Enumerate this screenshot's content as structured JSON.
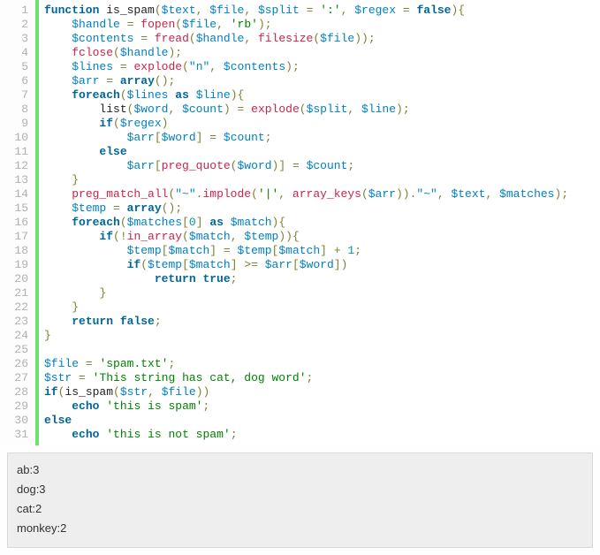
{
  "code": {
    "line_count": 31,
    "tokens": [
      [
        [
          "kw",
          "function"
        ],
        [
          "plain",
          " is_spam"
        ],
        [
          "op",
          "("
        ],
        [
          "var",
          "$text"
        ],
        [
          "op",
          ","
        ],
        [
          "plain",
          " "
        ],
        [
          "var",
          "$file"
        ],
        [
          "op",
          ","
        ],
        [
          "plain",
          " "
        ],
        [
          "var",
          "$split"
        ],
        [
          "plain",
          " "
        ],
        [
          "op",
          "="
        ],
        [
          "plain",
          " "
        ],
        [
          "strq",
          "':'"
        ],
        [
          "op",
          ","
        ],
        [
          "plain",
          " "
        ],
        [
          "var",
          "$regex"
        ],
        [
          "plain",
          " "
        ],
        [
          "op",
          "="
        ],
        [
          "plain",
          " "
        ],
        [
          "kw",
          "false"
        ],
        [
          "op",
          ")"
        ],
        [
          "op",
          "{"
        ]
      ],
      [
        [
          "plain",
          "    "
        ],
        [
          "var",
          "$handle"
        ],
        [
          "plain",
          " "
        ],
        [
          "op",
          "="
        ],
        [
          "plain",
          " "
        ],
        [
          "fn",
          "fopen"
        ],
        [
          "op",
          "("
        ],
        [
          "var",
          "$file"
        ],
        [
          "op",
          ","
        ],
        [
          "plain",
          " "
        ],
        [
          "strq",
          "'rb'"
        ],
        [
          "op",
          ")"
        ],
        [
          "op",
          ";"
        ]
      ],
      [
        [
          "plain",
          "    "
        ],
        [
          "var",
          "$contents"
        ],
        [
          "plain",
          " "
        ],
        [
          "op",
          "="
        ],
        [
          "plain",
          " "
        ],
        [
          "fn",
          "fread"
        ],
        [
          "op",
          "("
        ],
        [
          "var",
          "$handle"
        ],
        [
          "op",
          ","
        ],
        [
          "plain",
          " "
        ],
        [
          "fn",
          "filesize"
        ],
        [
          "op",
          "("
        ],
        [
          "var",
          "$file"
        ],
        [
          "op",
          ")"
        ],
        [
          "op",
          ")"
        ],
        [
          "op",
          ";"
        ]
      ],
      [
        [
          "plain",
          "    "
        ],
        [
          "fn",
          "fclose"
        ],
        [
          "op",
          "("
        ],
        [
          "var",
          "$handle"
        ],
        [
          "op",
          ")"
        ],
        [
          "op",
          ";"
        ]
      ],
      [
        [
          "plain",
          "    "
        ],
        [
          "var",
          "$lines"
        ],
        [
          "plain",
          " "
        ],
        [
          "op",
          "="
        ],
        [
          "plain",
          " "
        ],
        [
          "fn",
          "explode"
        ],
        [
          "op",
          "("
        ],
        [
          "str",
          "\"n\""
        ],
        [
          "op",
          ","
        ],
        [
          "plain",
          " "
        ],
        [
          "var",
          "$contents"
        ],
        [
          "op",
          ")"
        ],
        [
          "op",
          ";"
        ]
      ],
      [
        [
          "plain",
          "    "
        ],
        [
          "var",
          "$arr"
        ],
        [
          "plain",
          " "
        ],
        [
          "op",
          "="
        ],
        [
          "plain",
          " "
        ],
        [
          "kw",
          "array"
        ],
        [
          "op",
          "("
        ],
        [
          "op",
          ")"
        ],
        [
          "op",
          ";"
        ]
      ],
      [
        [
          "plain",
          "    "
        ],
        [
          "kw",
          "foreach"
        ],
        [
          "op",
          "("
        ],
        [
          "var",
          "$lines"
        ],
        [
          "plain",
          " "
        ],
        [
          "kw",
          "as"
        ],
        [
          "plain",
          " "
        ],
        [
          "var",
          "$line"
        ],
        [
          "op",
          ")"
        ],
        [
          "op",
          "{"
        ]
      ],
      [
        [
          "plain",
          "        list"
        ],
        [
          "op",
          "("
        ],
        [
          "var",
          "$word"
        ],
        [
          "op",
          ","
        ],
        [
          "plain",
          " "
        ],
        [
          "var",
          "$count"
        ],
        [
          "op",
          ")"
        ],
        [
          "plain",
          " "
        ],
        [
          "op",
          "="
        ],
        [
          "plain",
          " "
        ],
        [
          "fn",
          "explode"
        ],
        [
          "op",
          "("
        ],
        [
          "var",
          "$split"
        ],
        [
          "op",
          ","
        ],
        [
          "plain",
          " "
        ],
        [
          "var",
          "$line"
        ],
        [
          "op",
          ")"
        ],
        [
          "op",
          ";"
        ]
      ],
      [
        [
          "plain",
          "        "
        ],
        [
          "kw",
          "if"
        ],
        [
          "op",
          "("
        ],
        [
          "var",
          "$regex"
        ],
        [
          "op",
          ")"
        ]
      ],
      [
        [
          "plain",
          "            "
        ],
        [
          "var",
          "$arr"
        ],
        [
          "op",
          "["
        ],
        [
          "var",
          "$word"
        ],
        [
          "op",
          "]"
        ],
        [
          "plain",
          " "
        ],
        [
          "op",
          "="
        ],
        [
          "plain",
          " "
        ],
        [
          "var",
          "$count"
        ],
        [
          "op",
          ";"
        ]
      ],
      [
        [
          "plain",
          "        "
        ],
        [
          "kw",
          "else"
        ]
      ],
      [
        [
          "plain",
          "            "
        ],
        [
          "var",
          "$arr"
        ],
        [
          "op",
          "["
        ],
        [
          "fn",
          "preg_quote"
        ],
        [
          "op",
          "("
        ],
        [
          "var",
          "$word"
        ],
        [
          "op",
          ")"
        ],
        [
          "op",
          "]"
        ],
        [
          "plain",
          " "
        ],
        [
          "op",
          "="
        ],
        [
          "plain",
          " "
        ],
        [
          "var",
          "$count"
        ],
        [
          "op",
          ";"
        ]
      ],
      [
        [
          "plain",
          "    "
        ],
        [
          "op",
          "}"
        ]
      ],
      [
        [
          "plain",
          "    "
        ],
        [
          "fn",
          "preg_match_all"
        ],
        [
          "op",
          "("
        ],
        [
          "str",
          "\"~\""
        ],
        [
          "op",
          "."
        ],
        [
          "fn",
          "implode"
        ],
        [
          "op",
          "("
        ],
        [
          "strq",
          "'|'"
        ],
        [
          "op",
          ","
        ],
        [
          "plain",
          " "
        ],
        [
          "fn",
          "array_keys"
        ],
        [
          "op",
          "("
        ],
        [
          "var",
          "$arr"
        ],
        [
          "op",
          ")"
        ],
        [
          "op",
          ")"
        ],
        [
          "op",
          "."
        ],
        [
          "str",
          "\"~\""
        ],
        [
          "op",
          ","
        ],
        [
          "plain",
          " "
        ],
        [
          "var",
          "$text"
        ],
        [
          "op",
          ","
        ],
        [
          "plain",
          " "
        ],
        [
          "var",
          "$matches"
        ],
        [
          "op",
          ")"
        ],
        [
          "op",
          ";"
        ]
      ],
      [
        [
          "plain",
          "    "
        ],
        [
          "var",
          "$temp"
        ],
        [
          "plain",
          " "
        ],
        [
          "op",
          "="
        ],
        [
          "plain",
          " "
        ],
        [
          "kw",
          "array"
        ],
        [
          "op",
          "("
        ],
        [
          "op",
          ")"
        ],
        [
          "op",
          ";"
        ]
      ],
      [
        [
          "plain",
          "    "
        ],
        [
          "kw",
          "foreach"
        ],
        [
          "op",
          "("
        ],
        [
          "var",
          "$matches"
        ],
        [
          "op",
          "["
        ],
        [
          "num",
          "0"
        ],
        [
          "op",
          "]"
        ],
        [
          "plain",
          " "
        ],
        [
          "kw",
          "as"
        ],
        [
          "plain",
          " "
        ],
        [
          "var",
          "$match"
        ],
        [
          "op",
          ")"
        ],
        [
          "op",
          "{"
        ]
      ],
      [
        [
          "plain",
          "        "
        ],
        [
          "kw",
          "if"
        ],
        [
          "op",
          "("
        ],
        [
          "op",
          "!"
        ],
        [
          "fn",
          "in_array"
        ],
        [
          "op",
          "("
        ],
        [
          "var",
          "$match"
        ],
        [
          "op",
          ","
        ],
        [
          "plain",
          " "
        ],
        [
          "var",
          "$temp"
        ],
        [
          "op",
          ")"
        ],
        [
          "op",
          ")"
        ],
        [
          "op",
          "{"
        ]
      ],
      [
        [
          "plain",
          "            "
        ],
        [
          "var",
          "$temp"
        ],
        [
          "op",
          "["
        ],
        [
          "var",
          "$match"
        ],
        [
          "op",
          "]"
        ],
        [
          "plain",
          " "
        ],
        [
          "op",
          "="
        ],
        [
          "plain",
          " "
        ],
        [
          "var",
          "$temp"
        ],
        [
          "op",
          "["
        ],
        [
          "var",
          "$match"
        ],
        [
          "op",
          "]"
        ],
        [
          "plain",
          " "
        ],
        [
          "op",
          "+"
        ],
        [
          "plain",
          " "
        ],
        [
          "num",
          "1"
        ],
        [
          "op",
          ";"
        ]
      ],
      [
        [
          "plain",
          "            "
        ],
        [
          "kw",
          "if"
        ],
        [
          "op",
          "("
        ],
        [
          "var",
          "$temp"
        ],
        [
          "op",
          "["
        ],
        [
          "var",
          "$match"
        ],
        [
          "op",
          "]"
        ],
        [
          "plain",
          " "
        ],
        [
          "op",
          ">="
        ],
        [
          "plain",
          " "
        ],
        [
          "var",
          "$arr"
        ],
        [
          "op",
          "["
        ],
        [
          "var",
          "$word"
        ],
        [
          "op",
          "]"
        ],
        [
          "op",
          ")"
        ]
      ],
      [
        [
          "plain",
          "                "
        ],
        [
          "kw",
          "return"
        ],
        [
          "plain",
          " "
        ],
        [
          "kw",
          "true"
        ],
        [
          "op",
          ";"
        ]
      ],
      [
        [
          "plain",
          "        "
        ],
        [
          "op",
          "}"
        ]
      ],
      [
        [
          "plain",
          "    "
        ],
        [
          "op",
          "}"
        ]
      ],
      [
        [
          "plain",
          "    "
        ],
        [
          "kw",
          "return"
        ],
        [
          "plain",
          " "
        ],
        [
          "kw",
          "false"
        ],
        [
          "op",
          ";"
        ]
      ],
      [
        [
          "op",
          "}"
        ]
      ],
      [],
      [
        [
          "var",
          "$file"
        ],
        [
          "plain",
          " "
        ],
        [
          "op",
          "="
        ],
        [
          "plain",
          " "
        ],
        [
          "strq",
          "'spam.txt'"
        ],
        [
          "op",
          ";"
        ]
      ],
      [
        [
          "var",
          "$str"
        ],
        [
          "plain",
          " "
        ],
        [
          "op",
          "="
        ],
        [
          "plain",
          " "
        ],
        [
          "strq",
          "'This string has cat, dog word'"
        ],
        [
          "op",
          ";"
        ]
      ],
      [
        [
          "kw",
          "if"
        ],
        [
          "op",
          "("
        ],
        [
          "plain",
          "is_spam"
        ],
        [
          "op",
          "("
        ],
        [
          "var",
          "$str"
        ],
        [
          "op",
          ","
        ],
        [
          "plain",
          " "
        ],
        [
          "var",
          "$file"
        ],
        [
          "op",
          ")"
        ],
        [
          "op",
          ")"
        ]
      ],
      [
        [
          "plain",
          "    "
        ],
        [
          "kw",
          "echo"
        ],
        [
          "plain",
          " "
        ],
        [
          "strq",
          "'this is spam'"
        ],
        [
          "op",
          ";"
        ]
      ],
      [
        [
          "kw",
          "else"
        ]
      ],
      [
        [
          "plain",
          "    "
        ],
        [
          "kw",
          "echo"
        ],
        [
          "plain",
          " "
        ],
        [
          "strq",
          "'this is not spam'"
        ],
        [
          "op",
          ";"
        ]
      ]
    ]
  },
  "output": {
    "lines": [
      "ab:3",
      "dog:3",
      "cat:2",
      "monkey:2"
    ]
  }
}
